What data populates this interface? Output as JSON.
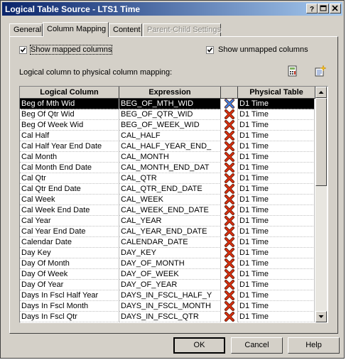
{
  "window": {
    "title": "Logical Table Source - LTS1 Time"
  },
  "tabs": [
    {
      "label": "General"
    },
    {
      "label": "Column Mapping"
    },
    {
      "label": "Content"
    },
    {
      "label": "Parent-Child Settings"
    }
  ],
  "options": {
    "show_mapped": {
      "label": "Show mapped columns",
      "checked": true
    },
    "show_unmapped": {
      "label": "Show unmapped columns",
      "checked": true
    }
  },
  "mapping_label": "Logical column to physical column mapping:",
  "toolbar_icons": [
    "expression-builder-icon",
    "new-mapping-icon"
  ],
  "grid": {
    "columns": [
      "Logical Column",
      "Expression",
      "",
      "Physical Table"
    ],
    "rows": [
      {
        "logical": "Beg of Mth Wid",
        "expression": "BEG_OF_MTH_WID",
        "table": "D1 Time"
      },
      {
        "logical": "Beg Of Qtr Wid",
        "expression": "BEG_OF_QTR_WID",
        "table": "D1 Time"
      },
      {
        "logical": "Beg Of Week Wid",
        "expression": "BEG_OF_WEEK_WID",
        "table": "D1 Time"
      },
      {
        "logical": "Cal Half",
        "expression": "CAL_HALF",
        "table": "D1 Time"
      },
      {
        "logical": "Cal Half Year End Date",
        "expression": "CAL_HALF_YEAR_END_",
        "table": "D1 Time"
      },
      {
        "logical": "Cal Month",
        "expression": "CAL_MONTH",
        "table": "D1 Time"
      },
      {
        "logical": "Cal Month End Date",
        "expression": "CAL_MONTH_END_DAT",
        "table": "D1 Time"
      },
      {
        "logical": "Cal Qtr",
        "expression": "CAL_QTR",
        "table": "D1 Time"
      },
      {
        "logical": "Cal Qtr End Date",
        "expression": "CAL_QTR_END_DATE",
        "table": "D1 Time"
      },
      {
        "logical": "Cal Week",
        "expression": "CAL_WEEK",
        "table": "D1 Time"
      },
      {
        "logical": "Cal Week End Date",
        "expression": "CAL_WEEK_END_DATE",
        "table": "D1 Time"
      },
      {
        "logical": "Cal Year",
        "expression": "CAL_YEAR",
        "table": "D1 Time"
      },
      {
        "logical": "Cal Year End Date",
        "expression": "CAL_YEAR_END_DATE",
        "table": "D1 Time"
      },
      {
        "logical": "Calendar Date",
        "expression": "CALENDAR_DATE",
        "table": "D1 Time"
      },
      {
        "logical": "Day Key",
        "expression": "DAY_KEY",
        "table": "D1 Time"
      },
      {
        "logical": "Day Of Month",
        "expression": "DAY_OF_MONTH",
        "table": "D1 Time"
      },
      {
        "logical": "Day Of Week",
        "expression": "DAY_OF_WEEK",
        "table": "D1 Time"
      },
      {
        "logical": "Day Of Year",
        "expression": "DAY_OF_YEAR",
        "table": "D1 Time"
      },
      {
        "logical": "Days In Fscl Half Year",
        "expression": "DAYS_IN_FSCL_HALF_Y",
        "table": "D1 Time"
      },
      {
        "logical": "Days In Fscl Month",
        "expression": "DAYS_IN_FSCL_MONTH",
        "table": "D1 Time"
      },
      {
        "logical": "Days In Fscl Qtr",
        "expression": "DAYS_IN_FSCL_QTR",
        "table": "D1 Time"
      }
    ],
    "selected_row": 0,
    "row_icon": "delete-x-icon"
  },
  "buttons": {
    "ok": "OK",
    "cancel": "Cancel",
    "help": "Help"
  },
  "colors": {
    "title_start": "#0a246a",
    "title_end": "#a6caf0",
    "delete_x": "#d83010",
    "selected_x": "#4080e0",
    "face": "#d4d0c8"
  }
}
